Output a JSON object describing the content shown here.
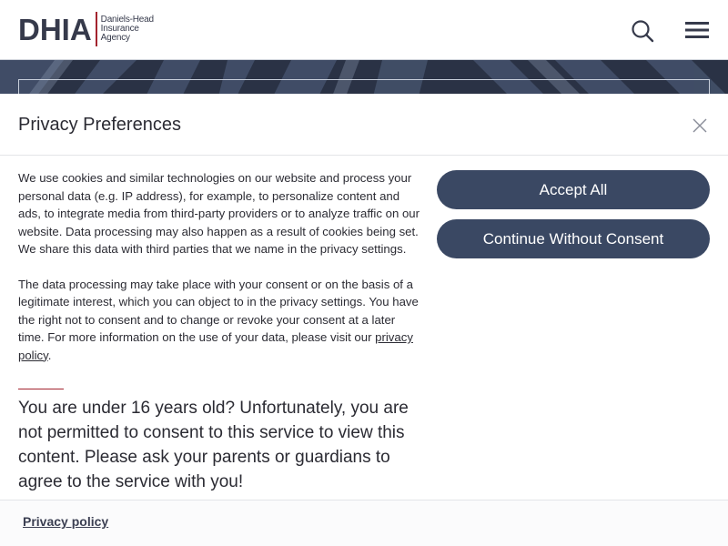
{
  "header": {
    "logo": {
      "mark": "DHIA",
      "sub_lines": [
        "Daniels-Head",
        "Insurance",
        "Agency"
      ]
    },
    "search_icon": "search-icon",
    "menu_icon": "hamburger-menu-icon"
  },
  "modal": {
    "title": "Privacy Preferences",
    "close_icon": "close-icon",
    "paragraph1": "We use cookies and similar technologies on our website and process your personal data (e.g. IP address), for example, to personalize content and ads, to integrate media from third-party providers or to analyze traffic on our website. Data processing may also happen as a result of cookies being set. We share this data with third parties that we name in the privacy settings.",
    "paragraph2_before": "The data processing may take place with your consent or on the basis of a legitimate interest, which you can object to in the privacy settings. You have the right not to consent and to change or revoke your consent at a later time. For more information on the use of your data, please visit our ",
    "paragraph2_link": "privacy policy",
    "paragraph2_after": ".",
    "age_warning": "You are under 16 years old? Unfortunately, you are not permitted to consent to this service to view this content. Please ask your parents or guardians to agree to the service with you!",
    "accept_all_label": "Accept All",
    "continue_label": "Continue Without Consent",
    "footer_link": "Privacy policy"
  },
  "colors": {
    "button_bg": "#3a4863",
    "accent_red": "#a3232e",
    "text": "#2b2b33",
    "hero_bg": "#2a3245"
  }
}
